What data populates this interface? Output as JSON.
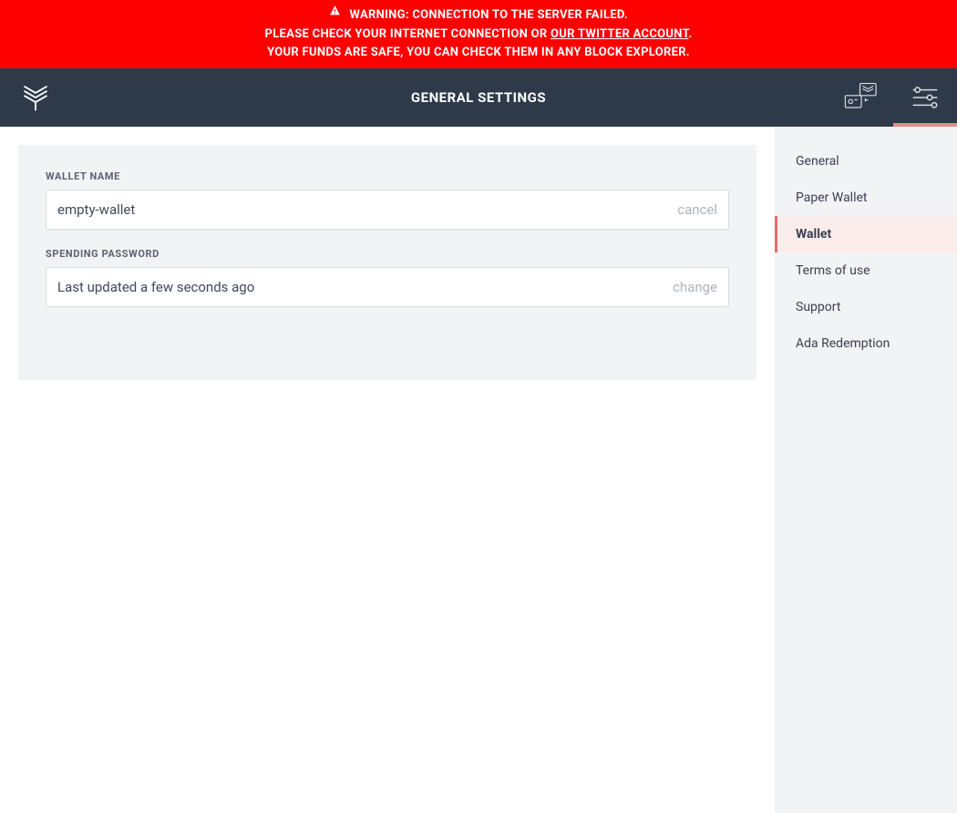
{
  "warning": {
    "line1": "WARNING: CONNECTION TO THE SERVER FAILED.",
    "line2_prefix": "PLEASE CHECK YOUR INTERNET CONNECTION OR ",
    "line2_link": "OUR TWITTER ACCOUNT",
    "line2_suffix": ".",
    "line3": "YOUR FUNDS ARE SAFE, YOU CAN CHECK THEM IN ANY BLOCK EXPLORER."
  },
  "header": {
    "title": "GENERAL SETTINGS"
  },
  "form": {
    "wallet_name": {
      "label": "WALLET NAME",
      "value": "empty-wallet",
      "action": "cancel"
    },
    "spending_password": {
      "label": "SPENDING PASSWORD",
      "value": "Last updated a few seconds ago",
      "action": "change"
    }
  },
  "sidebar": {
    "items": [
      {
        "label": "General",
        "active": false
      },
      {
        "label": "Paper Wallet",
        "active": false
      },
      {
        "label": "Wallet",
        "active": true
      },
      {
        "label": "Terms of use",
        "active": false
      },
      {
        "label": "Support",
        "active": false
      },
      {
        "label": "Ada Redemption",
        "active": false
      }
    ]
  }
}
